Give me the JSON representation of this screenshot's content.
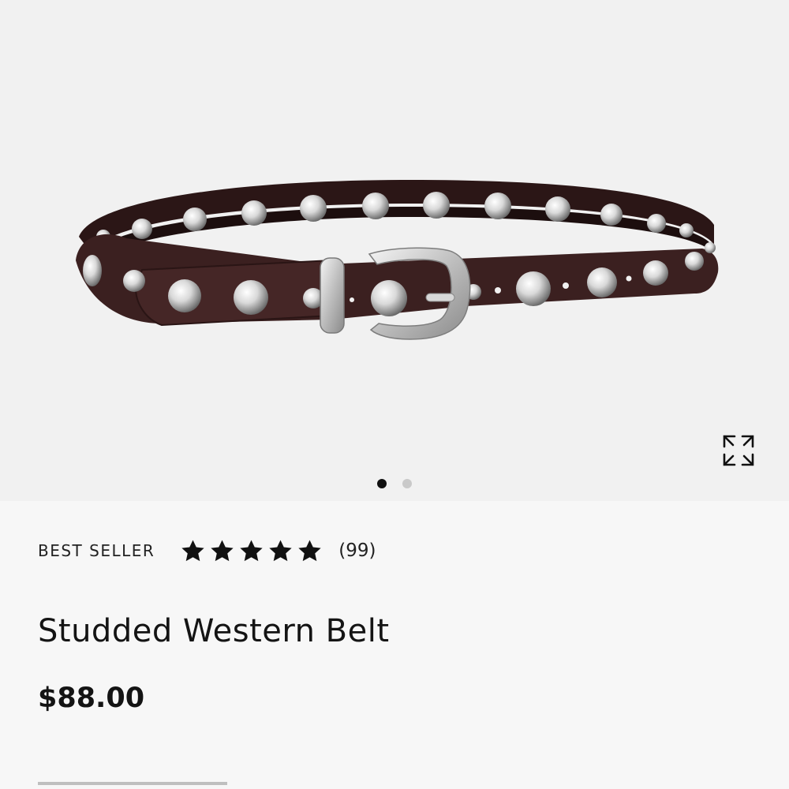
{
  "gallery": {
    "image_alt": "Studded Western Belt in dark brown leather with silver dome studs and western buckle",
    "expand_label": "Expand image",
    "slides_total": 2,
    "active_slide": 1
  },
  "product": {
    "badge": "BEST SELLER",
    "rating": 5,
    "rating_max": 5,
    "review_count": "(99)",
    "title": "Studded Western Belt",
    "price": "$88.00"
  },
  "colors": {
    "belt_leather": "#3b2020",
    "stud_silver": "#e6e6e6",
    "star": "#111111",
    "dot_active": "#111111",
    "dot_inactive": "#c9c9c9"
  },
  "icons": {
    "expand": "expand-arrows-icon",
    "star": "star-icon"
  }
}
